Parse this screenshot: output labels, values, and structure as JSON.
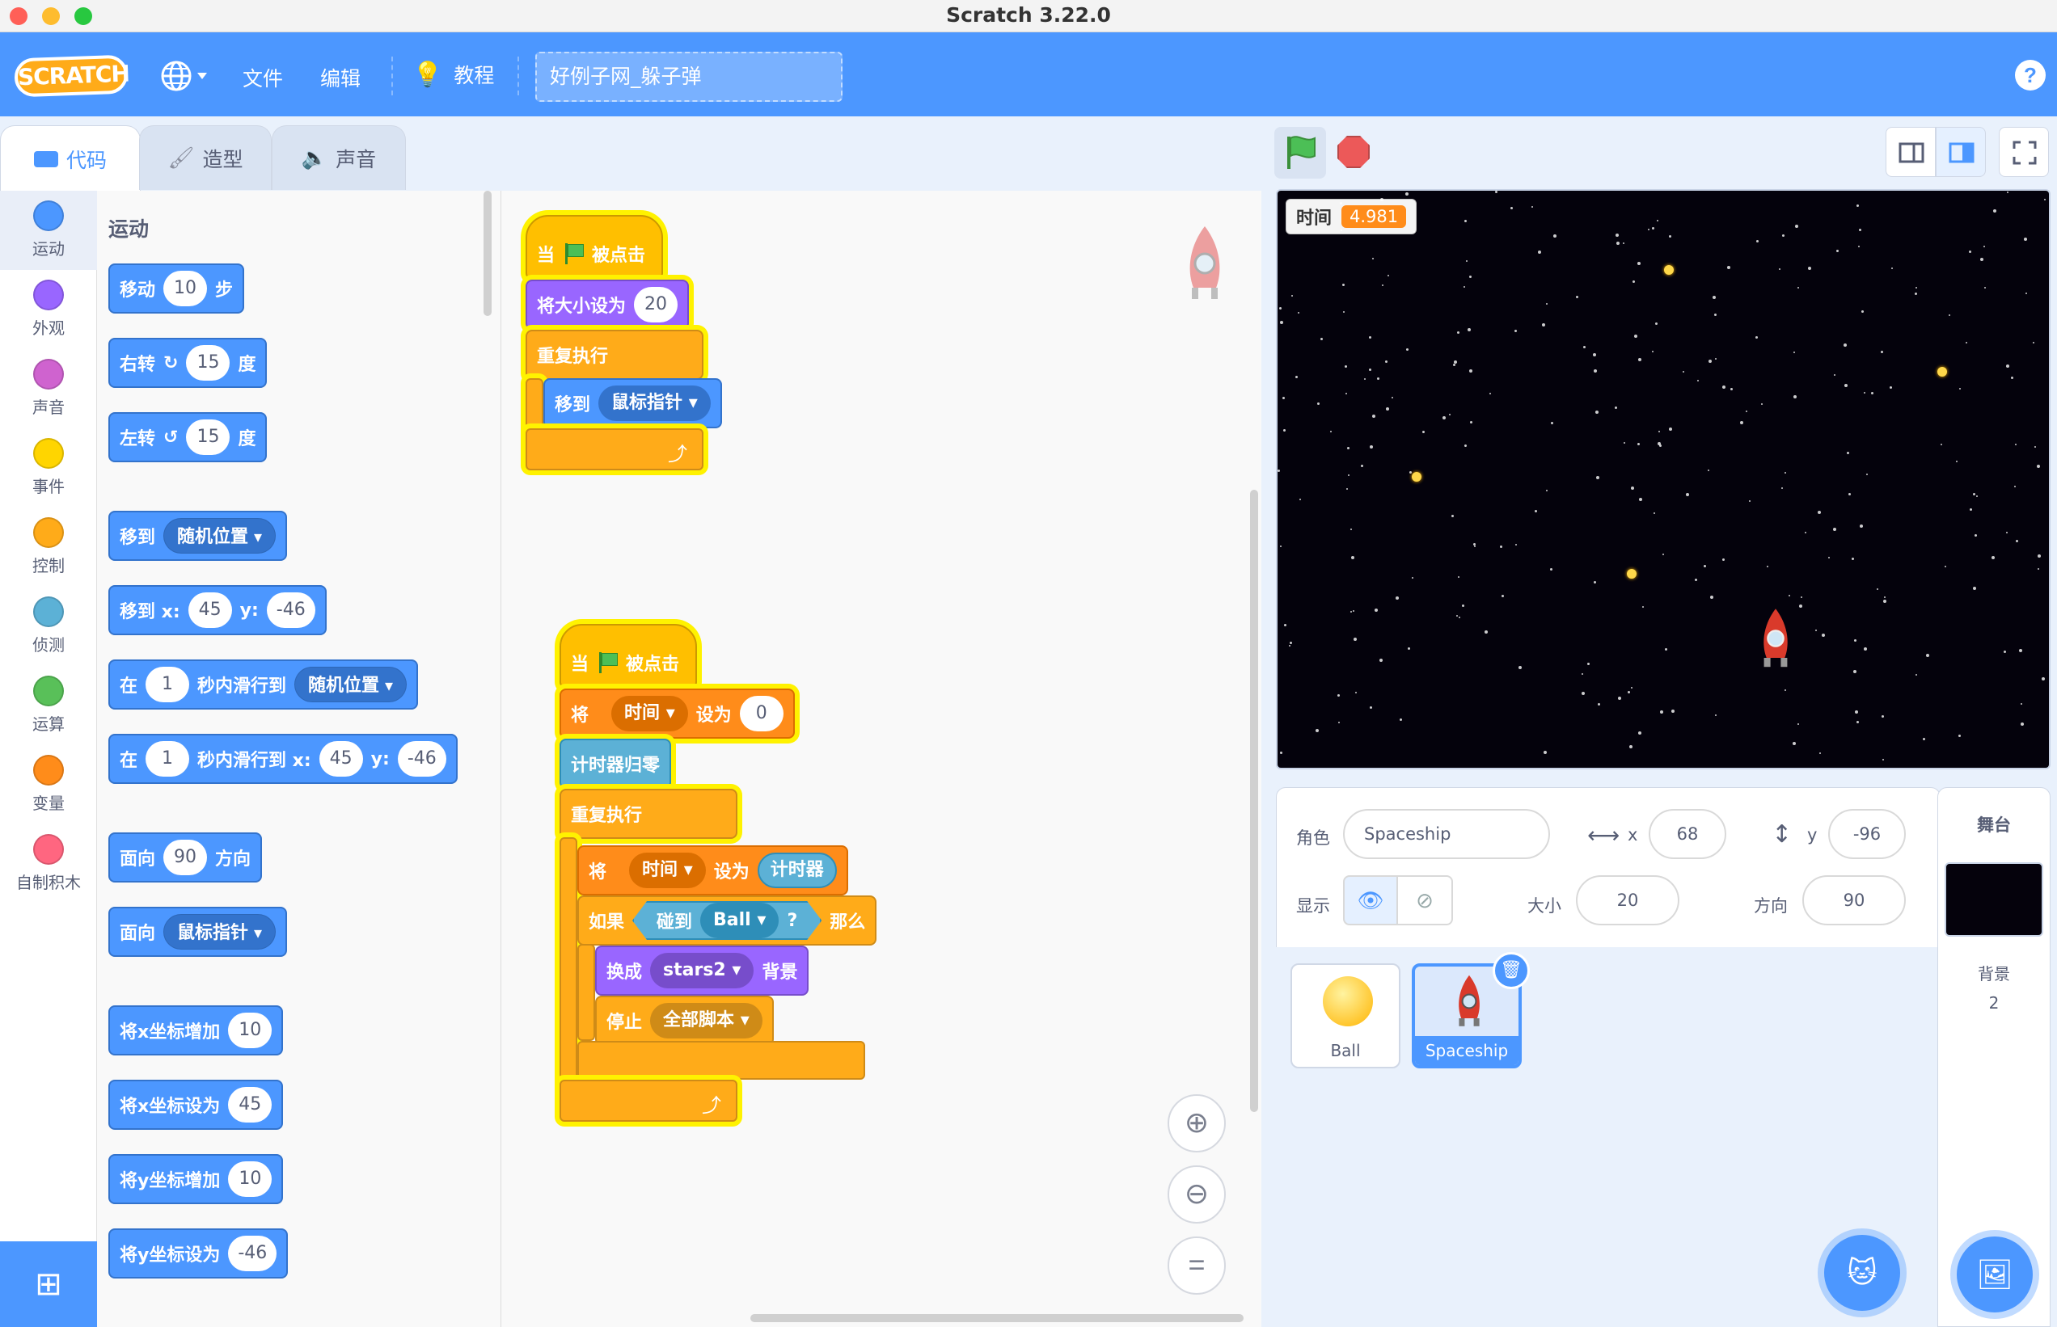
{
  "window": {
    "title": "Scratch 3.22.0"
  },
  "menubar": {
    "logo": "SCRATCH",
    "file": "文件",
    "edit": "编辑",
    "tutorials": "教程",
    "project_title": "好例子网_躲子弹",
    "help": "?"
  },
  "tabs": [
    {
      "label": "代码",
      "active": true
    },
    {
      "label": "造型",
      "active": false
    },
    {
      "label": "声音",
      "active": false
    }
  ],
  "categories": [
    {
      "label": "运动",
      "color": "#4c97ff"
    },
    {
      "label": "外观",
      "color": "#9966ff"
    },
    {
      "label": "声音",
      "color": "#cf63cf"
    },
    {
      "label": "事件",
      "color": "#ffd500"
    },
    {
      "label": "控制",
      "color": "#ffab19"
    },
    {
      "label": "侦测",
      "color": "#5cb1d6"
    },
    {
      "label": "运算",
      "color": "#59c059"
    },
    {
      "label": "变量",
      "color": "#ff8c1a"
    },
    {
      "label": "自制积木",
      "color": "#ff6680"
    }
  ],
  "palette": {
    "section": "运动",
    "move": {
      "a": "移动",
      "n": "10",
      "b": "步"
    },
    "turn_right": {
      "a": "右转",
      "n": "15",
      "b": "度"
    },
    "turn_left": {
      "a": "左转",
      "n": "15",
      "b": "度"
    },
    "goto": {
      "a": "移到",
      "opt": "随机位置"
    },
    "goto_xy": {
      "a": "移到 x:",
      "x": "45",
      "yl": "y:",
      "y": "-46"
    },
    "glide": {
      "a": "在",
      "n": "1",
      "b": "秒内滑行到",
      "opt": "随机位置"
    },
    "glide_xy": {
      "a": "在",
      "n": "1",
      "b": "秒内滑行到 x:",
      "x": "45",
      "yl": "y:",
      "y": "-46"
    },
    "point_dir": {
      "a": "面向",
      "n": "90",
      "b": "方向"
    },
    "point_to": {
      "a": "面向",
      "opt": "鼠标指针"
    },
    "change_x": {
      "a": "将x坐标增加",
      "n": "10"
    },
    "set_x": {
      "a": "将x坐标设为",
      "n": "45"
    },
    "change_y": {
      "a": "将y坐标增加",
      "n": "10"
    },
    "set_y": {
      "a": "将y坐标设为",
      "n": "-46"
    }
  },
  "script1": {
    "hat": {
      "a": "当",
      "b": "被点击"
    },
    "set_size": {
      "a": "将大小设为",
      "n": "20"
    },
    "forever": "重复执行",
    "goto": {
      "a": "移到",
      "opt": "鼠标指针"
    }
  },
  "script2": {
    "hat": {
      "a": "当",
      "b": "被点击"
    },
    "set_var": {
      "a": "将",
      "var": "时间",
      "b": "设为",
      "n": "0"
    },
    "reset_timer": "计时器归零",
    "forever": "重复执行",
    "set_var2": {
      "a": "将",
      "var": "时间",
      "b": "设为",
      "rep": "计时器"
    },
    "if": {
      "a": "如果",
      "touch": "碰到",
      "obj": "Ball",
      "q": "?",
      "then": "那么"
    },
    "switch_bg": {
      "a": "换成",
      "bg": "stars2",
      "b": "背景"
    },
    "stop": {
      "a": "停止",
      "opt": "全部脚本"
    }
  },
  "stage": {
    "monitor_label": "时间",
    "monitor_value": "4.981"
  },
  "sprite_info": {
    "sprite_label": "角色",
    "sprite_name": "Spaceship",
    "x_label": "x",
    "x": "68",
    "y_label": "y",
    "y": "-96",
    "show_label": "显示",
    "size_label": "大小",
    "size": "20",
    "direction_label": "方向",
    "direction": "90"
  },
  "sprites": [
    {
      "name": "Ball",
      "selected": false
    },
    {
      "name": "Spaceship",
      "selected": true
    }
  ],
  "stage_panel": {
    "header": "舞台",
    "backdrops_label": "背景",
    "backdrops_count": "2"
  }
}
